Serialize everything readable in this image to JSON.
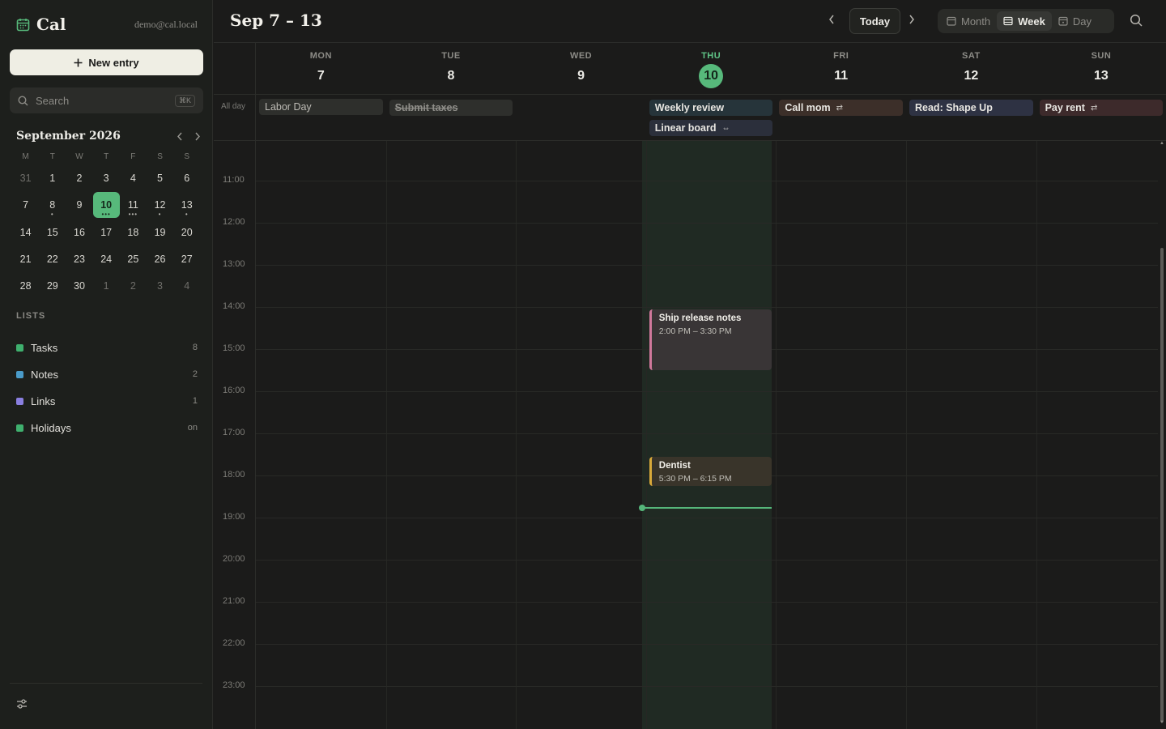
{
  "app": {
    "name": "Cal",
    "user_email": "demo@cal.local"
  },
  "sidebar": {
    "new_entry_label": "New entry",
    "search": {
      "placeholder": "Search",
      "shortcut": "⌘K"
    },
    "mini_calendar": {
      "title": "September 2026",
      "weekdays": [
        "M",
        "T",
        "W",
        "T",
        "F",
        "S",
        "S"
      ],
      "weeks": [
        [
          {
            "d": "31",
            "muted": true
          },
          {
            "d": "1"
          },
          {
            "d": "2"
          },
          {
            "d": "3"
          },
          {
            "d": "4"
          },
          {
            "d": "5"
          },
          {
            "d": "6"
          }
        ],
        [
          {
            "d": "7"
          },
          {
            "d": "8",
            "dots": "•"
          },
          {
            "d": "9"
          },
          {
            "d": "10",
            "today": true,
            "dots": "•••"
          },
          {
            "d": "11",
            "dots": "•••"
          },
          {
            "d": "12",
            "dots": "•"
          },
          {
            "d": "13",
            "dots": "•"
          }
        ],
        [
          {
            "d": "14"
          },
          {
            "d": "15"
          },
          {
            "d": "16"
          },
          {
            "d": "17"
          },
          {
            "d": "18"
          },
          {
            "d": "19"
          },
          {
            "d": "20"
          }
        ],
        [
          {
            "d": "21"
          },
          {
            "d": "22"
          },
          {
            "d": "23"
          },
          {
            "d": "24"
          },
          {
            "d": "25"
          },
          {
            "d": "26"
          },
          {
            "d": "27"
          }
        ],
        [
          {
            "d": "28"
          },
          {
            "d": "29"
          },
          {
            "d": "30"
          },
          {
            "d": "1",
            "muted": true
          },
          {
            "d": "2",
            "muted": true
          },
          {
            "d": "3",
            "muted": true
          },
          {
            "d": "4",
            "muted": true
          }
        ]
      ]
    },
    "lists_label": "LISTS",
    "lists": [
      {
        "name": "Tasks",
        "count": "8",
        "color": "#3fb06e"
      },
      {
        "name": "Notes",
        "count": "2",
        "color": "#4a9bc9"
      },
      {
        "name": "Links",
        "count": "1",
        "color": "#8a7fe0"
      },
      {
        "name": "Holidays",
        "count": "on",
        "color": "#3fb06e"
      }
    ]
  },
  "header": {
    "range_title": "Sep 7 – 13",
    "today_label": "Today",
    "views": [
      {
        "label": "Month",
        "active": false
      },
      {
        "label": "Week",
        "active": true
      },
      {
        "label": "Day",
        "active": false
      }
    ]
  },
  "days": [
    {
      "dow": "MON",
      "num": "7"
    },
    {
      "dow": "TUE",
      "num": "8"
    },
    {
      "dow": "WED",
      "num": "9"
    },
    {
      "dow": "THU",
      "num": "10",
      "today": true
    },
    {
      "dow": "FRI",
      "num": "11"
    },
    {
      "dow": "SAT",
      "num": "12"
    },
    {
      "dow": "SUN",
      "num": "13"
    }
  ],
  "allday": {
    "label": "All day",
    "events": [
      {
        "title": "Labor Day",
        "day": 0,
        "row": 0,
        "bg": "#2e2f2c",
        "fg": "#bdbbb5",
        "weight": "normal"
      },
      {
        "title": "Submit taxes",
        "day": 1,
        "row": 0,
        "bg": "#2e2f2c",
        "fg": "#8f8e89",
        "strike": true
      },
      {
        "title": "Weekly review",
        "day": 3,
        "row": 0,
        "bg": "#26343a",
        "fg": "#e8e6e1"
      },
      {
        "title": "Linear board",
        "day": 3,
        "row": 1,
        "bg": "#2b2f3b",
        "fg": "#e8e6e1",
        "icon": "⇔"
      },
      {
        "title": "Call mom",
        "day": 4,
        "row": 0,
        "bg": "#3c2f29",
        "fg": "#e8e6e1",
        "icon": "⇄"
      },
      {
        "title": "Read: Shape Up",
        "day": 5,
        "row": 0,
        "bg": "#2e3243",
        "fg": "#e8e6e1"
      },
      {
        "title": "Pay rent",
        "day": 6,
        "row": 0,
        "bg": "#3d2a2b",
        "fg": "#e8e6e1",
        "icon": "⇄"
      }
    ]
  },
  "hours": [
    "11:00",
    "12:00",
    "13:00",
    "14:00",
    "15:00",
    "16:00",
    "17:00",
    "18:00",
    "19:00",
    "20:00",
    "21:00",
    "22:00",
    "23:00"
  ],
  "events": [
    {
      "title": "Ship release notes",
      "time": "2:00 PM – 3:30 PM",
      "day": 3,
      "start": 14.0,
      "end": 15.5,
      "bg": "#393536",
      "border": "#d1789c"
    },
    {
      "title": "Dentist",
      "time": "5:30 PM – 6:15 PM",
      "day": 3,
      "start": 17.5,
      "end": 18.25,
      "bg": "#39342a",
      "border": "#d9a93a"
    }
  ],
  "now": {
    "hour": 18.75
  },
  "colors": {
    "accent": "#57b97b"
  }
}
